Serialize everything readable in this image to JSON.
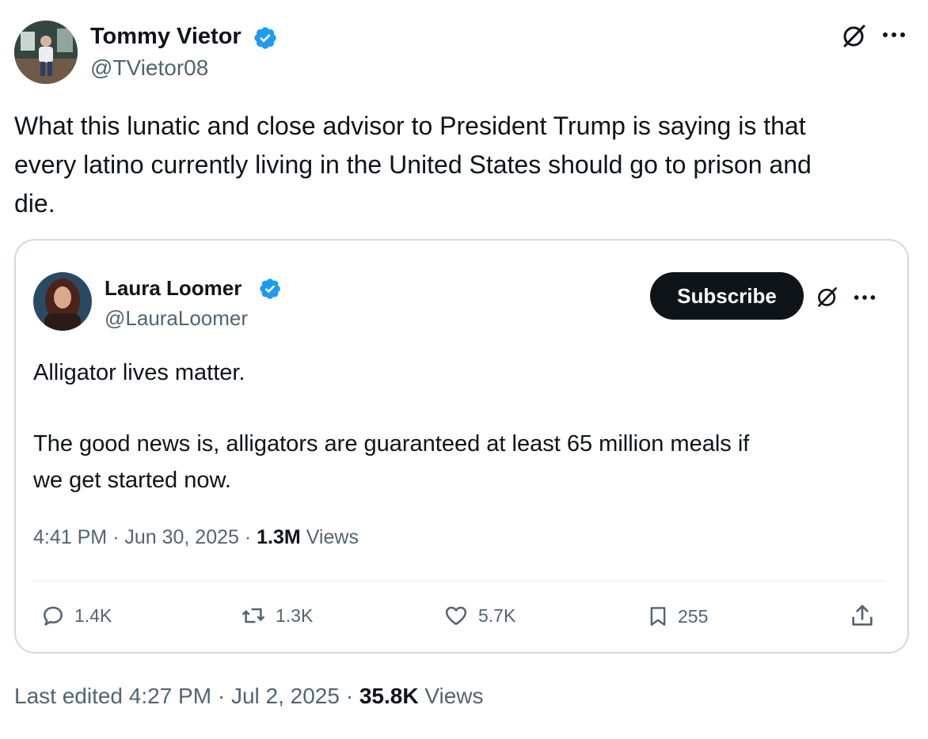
{
  "author": {
    "name": "Tommy Vietor",
    "handle": "@TVietor08",
    "verified": true
  },
  "tweet": {
    "text_lines": [
      "What this lunatic and close advisor to President Trump is saying is that",
      "every latino currently living in the United States should go to prison and",
      "die."
    ]
  },
  "quoted": {
    "author": {
      "name": "Laura Loomer",
      "handle": "@LauraLoomer",
      "verified": true
    },
    "subscribe_label": "Subscribe",
    "text_line1": "Alligator lives matter.",
    "text_line2": "The good news is, alligators are guaranteed at least 65 million meals if",
    "text_line3": "we get started now.",
    "meta": {
      "time": "4:41 PM",
      "date": "Jun 30, 2025",
      "views_count": "1.3M",
      "views_label": "Views",
      "sep": "·"
    },
    "actions": {
      "replies": "1.4K",
      "reposts": "1.3K",
      "likes": "5.7K",
      "bookmarks": "255"
    }
  },
  "footer": {
    "edited_label": "Last edited 4:27 PM",
    "date": "Jul 2, 2025",
    "views_count": "35.8K",
    "views_label": "Views",
    "sep": "·"
  },
  "colors": {
    "verified_badge": "#1d9bf0",
    "secondary_text": "#536471",
    "border": "#cfd9de",
    "primary_text": "#0f1419"
  }
}
